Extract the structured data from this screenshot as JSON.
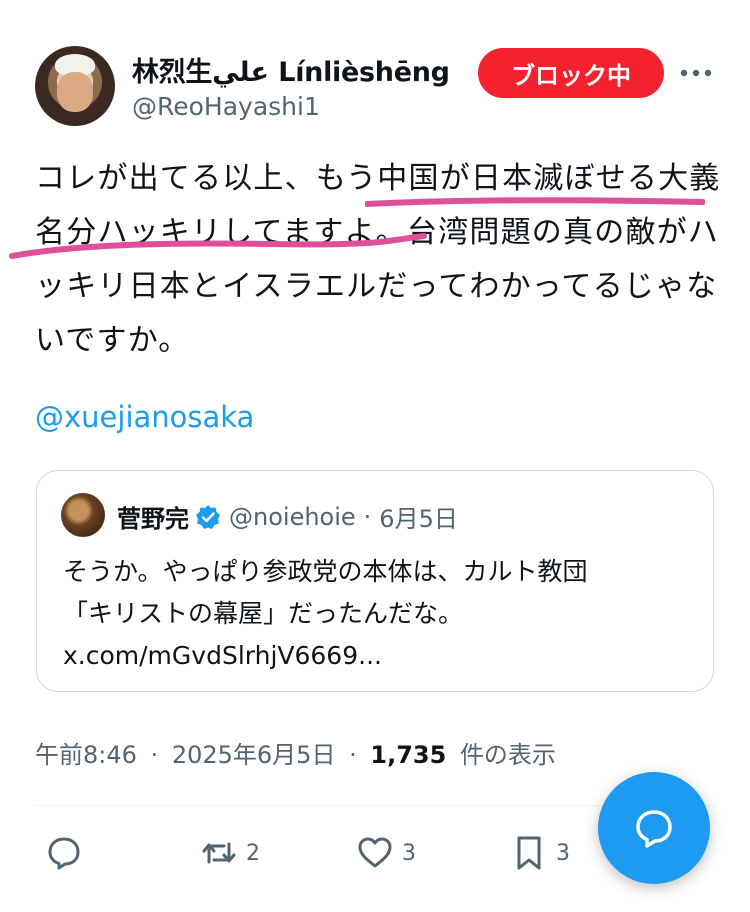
{
  "author": {
    "name": "林烈生علي Línlièshēng",
    "handle": "@ReoHayashi1"
  },
  "blocked_button": "ブロック中",
  "tweet": {
    "text": "コレが出てる以上、もう中国が日本滅ぼせる大義名分ハッキリしてますよ。台湾問題の真の敵がハッキリ日本とイスラエルだってわかってるじゃないですか。",
    "mention": "@xuejianosaka",
    "highlight_color": "#e0509a"
  },
  "quote": {
    "name": "菅野完",
    "handle": "@noiehoie",
    "separator": "·",
    "date": "6月5日",
    "text_line1": "そうか。やっぱり参政党の本体は、カルト教団",
    "text_line2": "「キリストの幕屋」だったんだな。",
    "link": "x.com/mGvdSlrhjV6669..."
  },
  "meta": {
    "time": "午前8:46",
    "sep1": "·",
    "date": "2025年6月5日",
    "sep2": "·",
    "views_count": "1,735",
    "views_label": "件の表示"
  },
  "actions": {
    "replies": "",
    "reposts": "2",
    "likes": "3",
    "bookmarks": "3"
  },
  "colors": {
    "accent": "#1d9bf0",
    "blocked": "#f4212e",
    "secondary_text": "#536471"
  },
  "icons": [
    "more-icon",
    "verified-icon",
    "reply-icon",
    "repost-icon",
    "like-icon",
    "bookmark-icon",
    "compose-reply-icon"
  ]
}
